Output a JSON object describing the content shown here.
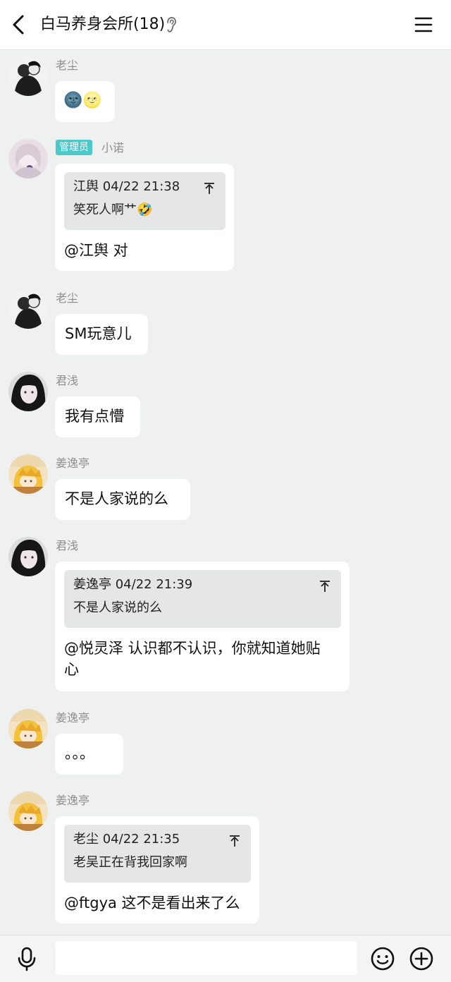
{
  "header": {
    "title": "白马养身会所(18)"
  },
  "badges": {
    "admin": "管理员"
  },
  "messages": [
    {
      "sender": "老尘",
      "text": "🌚🌝"
    },
    {
      "sender": "小诺",
      "quote": {
        "head": "江舆 04/22 21:38",
        "text": "笑死人啊艹🤣"
      },
      "text": "@江舆 对"
    },
    {
      "sender": "老尘",
      "text": "SM玩意儿"
    },
    {
      "sender": "君浅",
      "text": "我有点懵"
    },
    {
      "sender": "姜逸亭",
      "text": "不是人家说的么"
    },
    {
      "sender": "君浅",
      "quote": {
        "head": "姜逸亭 04/22 21:39",
        "text": "不是人家说的么"
      },
      "text": "@悦灵泽 认识都不认识，你就知道她贴心"
    },
    {
      "sender": "姜逸亭",
      "text": "。。。"
    },
    {
      "sender": "姜逸亭",
      "quote": {
        "head": "老尘 04/22 21:35",
        "text": "老吴正在背我回家啊"
      },
      "text": "@ftgya 这不是看出来了么"
    }
  ],
  "input": {
    "placeholder": ""
  },
  "icons": {
    "back": "back-arrow-icon",
    "ear": "ear-icon",
    "menu": "menu-icon",
    "mic": "microphone-icon",
    "emoji": "emoji-icon",
    "plus": "plus-icon"
  }
}
